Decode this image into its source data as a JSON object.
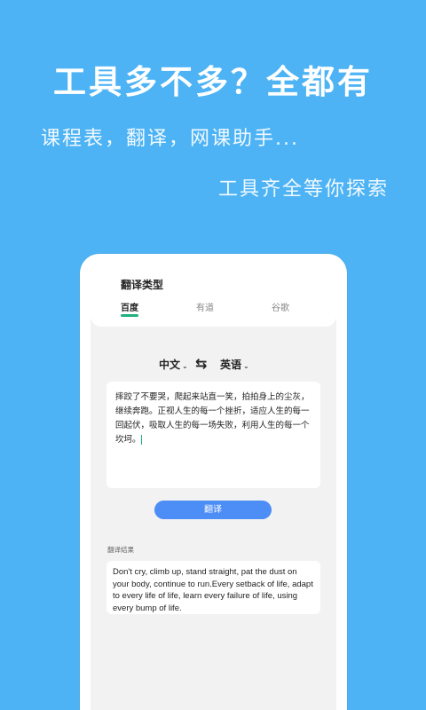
{
  "promo": {
    "headline": "工具多不多？全都有",
    "subtitle1": "课程表，翻译，网课助手...",
    "subtitle2": "工具齐全等你探索"
  },
  "translate_screen": {
    "type_title": "翻译类型",
    "tabs": [
      {
        "label": "百度",
        "active": true
      },
      {
        "label": "有道",
        "active": false
      },
      {
        "label": "谷歌",
        "active": false
      }
    ],
    "source_lang": "中文",
    "target_lang": "英语",
    "input_text": "摔跤了不要哭，爬起来站直一笑，拍拍身上的尘灰，继续奔跑。正视人生的每一个挫折，适应人生的每一回起伏，吸取人生的每一场失败，利用人生的每一个坎坷。",
    "translate_button": "翻译",
    "result_label": "翻译结果",
    "result_text": "Don't cry, climb up, stand straight, pat the dust on your body, continue to run.Every setback of life, adapt to every life of life, learn every failure of life, using every bump of life."
  },
  "colors": {
    "background": "#4DB3F4",
    "accent_green": "#22B07D",
    "button_blue": "#4C8DF6"
  },
  "icons": {
    "swap": "swap-arrows-icon",
    "dropdown": "chevron-down-icon"
  }
}
